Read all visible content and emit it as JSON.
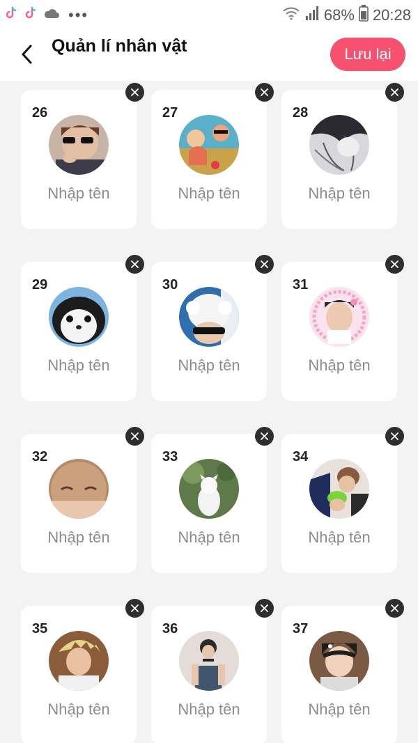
{
  "status_bar": {
    "battery": "68%",
    "time": "20:28",
    "left_icons": [
      "tiktok-icon",
      "tiktok-icon",
      "cloud-icon",
      "more-dots-icon"
    ],
    "right_icons": [
      "wifi-icon",
      "signal-icon",
      "battery-icon"
    ]
  },
  "header": {
    "title": "Quản lí nhân vật",
    "save_label": "Lưu lại",
    "back_icon": "chevron-left-icon"
  },
  "colors": {
    "accent": "#f6526f",
    "background": "#f3f3f3",
    "card": "#ffffff",
    "delete_badge": "#2e2e2e",
    "placeholder_text": "#8c8c8c"
  },
  "characters": [
    {
      "number": "26",
      "placeholder": "Nhập tên"
    },
    {
      "number": "27",
      "placeholder": "Nhập tên"
    },
    {
      "number": "28",
      "placeholder": "Nhập tên"
    },
    {
      "number": "29",
      "placeholder": "Nhập tên"
    },
    {
      "number": "30",
      "placeholder": "Nhập tên"
    },
    {
      "number": "31",
      "placeholder": "Nhập tên"
    },
    {
      "number": "32",
      "placeholder": "Nhập tên"
    },
    {
      "number": "33",
      "placeholder": "Nhập tên"
    },
    {
      "number": "34",
      "placeholder": "Nhập tên"
    },
    {
      "number": "35",
      "placeholder": "Nhập tên"
    },
    {
      "number": "36",
      "placeholder": "Nhập tên"
    },
    {
      "number": "37",
      "placeholder": "Nhập tên"
    }
  ]
}
